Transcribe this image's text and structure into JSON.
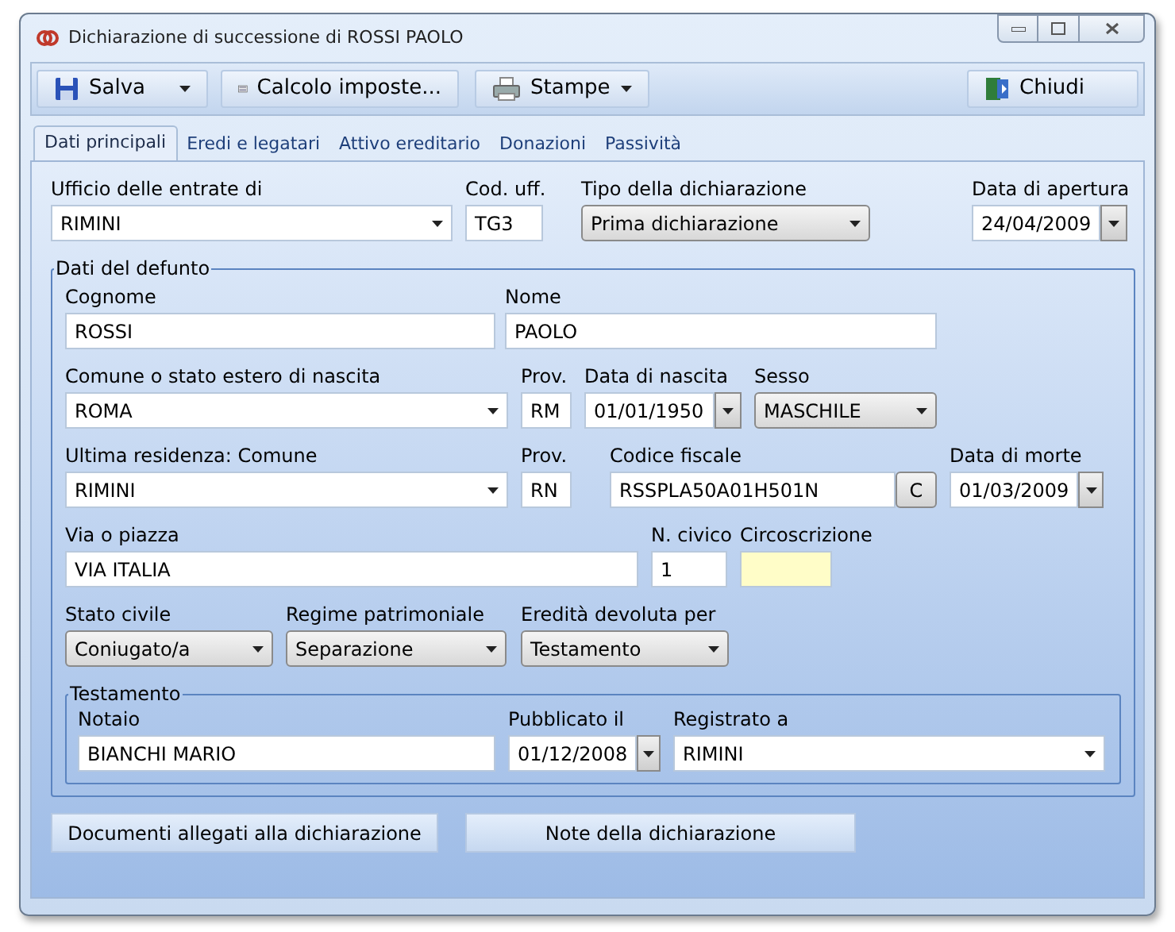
{
  "window": {
    "title": "Dichiarazione di successione di ROSSI PAOLO"
  },
  "toolbar": [
    {
      "label": "Salva",
      "dropdown": true
    },
    {
      "label": "Calcolo imposte...",
      "dropdown": false
    },
    {
      "label": "Stampe",
      "dropdown": true
    },
    {
      "label": "Chiudi",
      "dropdown": false
    }
  ],
  "tabs": [
    {
      "label": "Dati principali",
      "selected": true
    },
    {
      "label": "Eredi e legatari",
      "selected": false
    },
    {
      "label": "Attivo ereditario",
      "selected": false
    },
    {
      "label": "Donazioni",
      "selected": false
    },
    {
      "label": "Passività",
      "selected": false
    }
  ],
  "header_fields": [
    {
      "label": "Ufficio delle entrate di",
      "value": "RIMINI",
      "kind": "combo"
    },
    {
      "label": "Cod. uff.",
      "value": "TG3",
      "kind": "text"
    },
    {
      "label": "Tipo della dichiarazione",
      "value": "Prima dichiarazione",
      "kind": "select"
    },
    {
      "label": "Data di apertura",
      "value": "24/04/2009",
      "kind": "date"
    }
  ],
  "deceased": {
    "title": "Dati del defunto",
    "rows": [
      {
        "fields": [
          {
            "label": "Cognome",
            "value": "ROSSI",
            "kind": "text"
          },
          {
            "label": "Nome",
            "value": "PAOLO",
            "kind": "text"
          }
        ]
      },
      {
        "fields": [
          {
            "label": "Comune o stato estero di nascita",
            "value": "ROMA",
            "kind": "combo"
          },
          {
            "label": "Prov.",
            "value": "RM",
            "kind": "text"
          },
          {
            "label": "Data di nascita",
            "value": "01/01/1950",
            "kind": "date"
          },
          {
            "label": "Sesso",
            "value": "MASCHILE",
            "kind": "select"
          }
        ]
      },
      {
        "fields": [
          {
            "label": "Ultima residenza: Comune",
            "value": "RIMINI",
            "kind": "combo"
          },
          {
            "label": "Prov.",
            "value": "RN",
            "kind": "text"
          },
          {
            "label": "Codice fiscale",
            "value": "RSSPLA50A01H501N",
            "kind": "code",
            "button": "C"
          },
          {
            "label": "Data di morte",
            "value": "01/03/2009",
            "kind": "date"
          }
        ]
      },
      {
        "fields": [
          {
            "label": "Via o piazza",
            "value": "VIA ITALIA",
            "kind": "text"
          },
          {
            "label": "N. civico",
            "value": "1",
            "kind": "text"
          },
          {
            "label": "Circoscrizione",
            "kind": "highlight"
          }
        ]
      },
      {
        "fields": [
          {
            "label": "Stato civile",
            "value": "Coniugato/a",
            "kind": "select"
          },
          {
            "label": "Regime patrimoniale",
            "value": "Separazione",
            "kind": "select"
          },
          {
            "label": "Eredità devoluta per",
            "value": "Testamento",
            "kind": "select"
          }
        ]
      }
    ]
  },
  "will": {
    "title": "Testamento",
    "fields": [
      {
        "label": "Notaio",
        "value": "BIANCHI MARIO",
        "kind": "text"
      },
      {
        "label": "Pubblicato il",
        "value": "01/12/2008",
        "kind": "date"
      },
      {
        "label": "Registrato a",
        "value": "RIMINI",
        "kind": "combo"
      }
    ]
  },
  "bottom_buttons": [
    "Documenti allegati alla dichiarazione",
    "Note della dichiarazione"
  ]
}
